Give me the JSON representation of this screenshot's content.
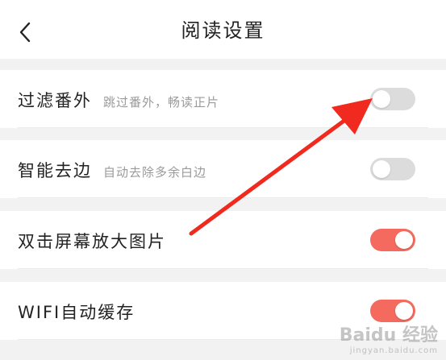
{
  "header": {
    "title": "阅读设置"
  },
  "settings": [
    {
      "label": "过滤番外",
      "desc": "跳过番外，畅读正片",
      "state": "off"
    },
    {
      "label": "智能去边",
      "desc": "自动去除多余白边",
      "state": "off"
    },
    {
      "label": "双击屏幕放大图片",
      "desc": "",
      "state": "on"
    },
    {
      "label": "WIFI自动缓存",
      "desc": "",
      "state": "on"
    }
  ],
  "colors": {
    "accent": "#f46a5e",
    "arrow": "#f02a1e",
    "toggle_off": "#dcdcdc"
  },
  "watermark": {
    "main": "Baidu 经验",
    "sub": "jingyan.baidu.com"
  }
}
